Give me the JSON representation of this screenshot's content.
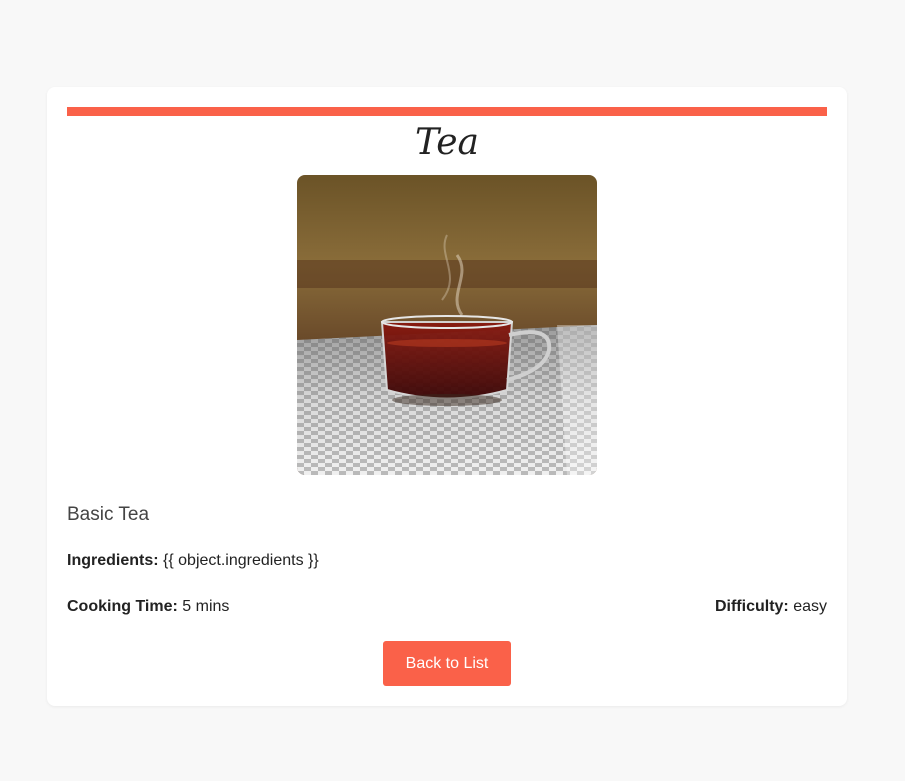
{
  "recipe": {
    "title": "Tea",
    "image_alt": "cup of tea",
    "description": "Basic Tea",
    "ingredients_label": "Ingredients:",
    "ingredients_value": "{{ object.ingredients }}",
    "cooking_time_label": "Cooking Time:",
    "cooking_time_value": "5 mins",
    "difficulty_label": "Difficulty:",
    "difficulty_value": "easy"
  },
  "actions": {
    "back_label": "Back to List"
  },
  "colors": {
    "accent": "#fa6149",
    "background": "#f8f8f8",
    "card": "#ffffff"
  }
}
